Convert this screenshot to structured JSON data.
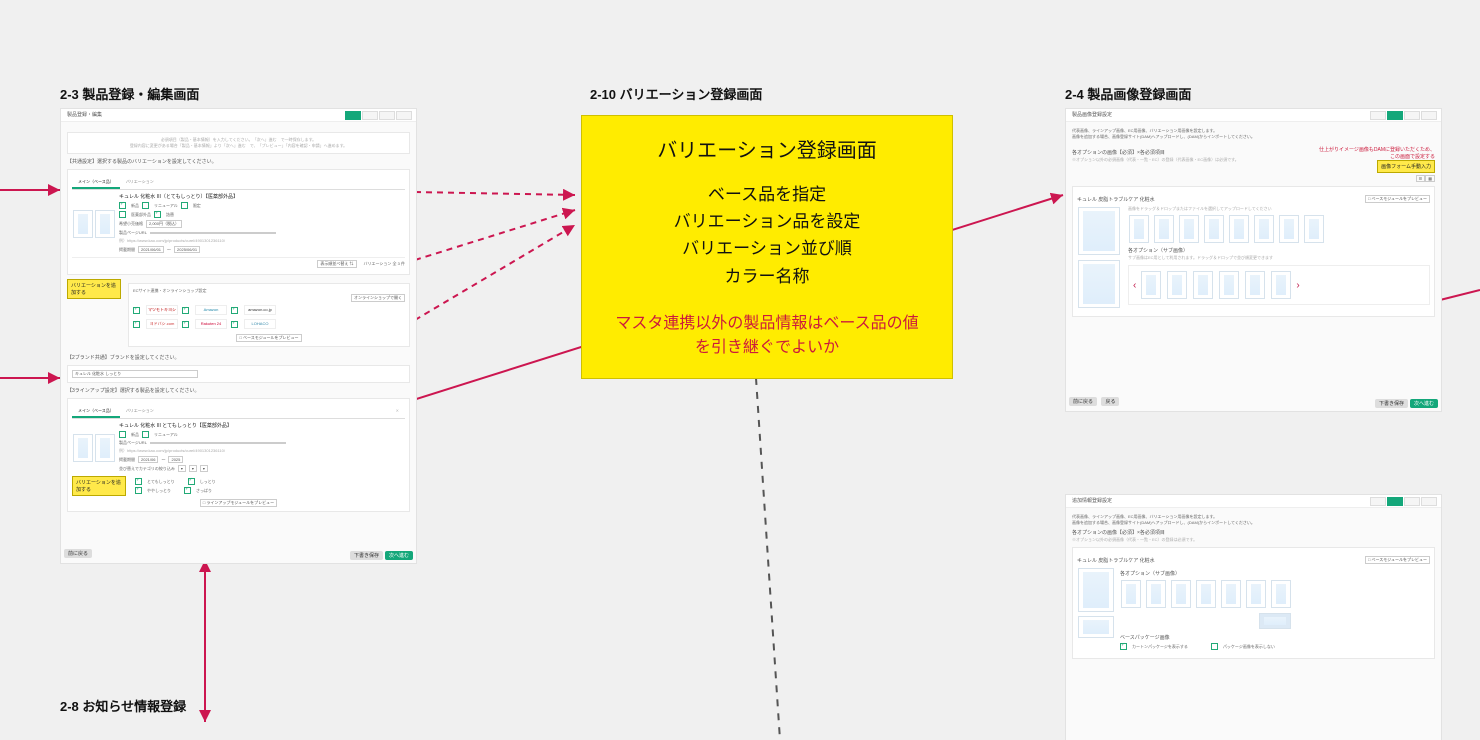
{
  "labels": {
    "s23": "2-3 製品登録・編集画面",
    "s210": "2-10 バリエーション登録画面",
    "s24": "2-4 製品画像登録画面",
    "s28": "2-8 お知らせ情報登録"
  },
  "yellow": {
    "title": "バリエーション登録画面",
    "line1": "ベース品を指定",
    "line2": "バリエーション品を設定",
    "line3": "バリエーション並び順",
    "line4": "カラー名称",
    "q1": "マスタ連携以外の製品情報はベース品の値",
    "q2": "を引き継ぐでよいか"
  },
  "m23": {
    "header": "製品登録・編集",
    "intro1": "必須項目（製品・基本情報）を入力してください。「次へ」進む　で一時保存します。",
    "intro2": "登録内容に変更がある場合「製品・基本情報」より「次へ」進む　で、「プレビュー」「内容を確認・申請」へ進めます。",
    "sec1_title": "【共通設定】選択する製品のバリエーションを設定してください。",
    "tab_main": "メイン（ベース品）",
    "tab_var": "バリエーション",
    "prod_name": "キュレル 化粧水 III（とてもしっとり）【医薬部外品】",
    "opts": [
      "新品",
      "リニューアル",
      "限定",
      "医薬部外品",
      "詰替"
    ],
    "field_price": "希望小売価格",
    "price_val": "2,000円（税込）",
    "field_url": "製品ページURL",
    "url_example": "例）https://www.kao.com/jp/products/curel/4901301236110/",
    "date_label": "掲載期間",
    "arrange": "表示順並べ替え ⇅",
    "total": "バリエーション 全 3 件",
    "add_variation": "バリエーションを追加する",
    "ec_title": "ECサイト連携・オンラインショップ設定",
    "ec_open": "オンラインショップで開く",
    "ec": [
      "マツモトキヨシ",
      "Amazon",
      "amazon.co.jp",
      "ヨドバシ.com",
      "Rakuten 24",
      "LOHACO"
    ],
    "preview": "□ ベースモジュールをプレビュー",
    "sec2_title": "【2ブランド共通】ブランドを設定してください。",
    "brand_val": "キュレル 化粧水 しっとり",
    "sec3_title": "【3ラインアップ設定】選択する製品を設定してください。",
    "lineup_name": "キュレル 化粧水 III とてもしっとり【医薬部外品】",
    "sort_text": "並び替えでカテゴリの絞り込み",
    "lopts": [
      "とてもしっとり",
      "しっとり",
      "ややしっとり",
      "さっぱり"
    ],
    "preview2": "□ ラインアップモジュールをプレビュー",
    "back": "前に戻る",
    "draft": "下書き保存",
    "next": "次へ進む"
  },
  "m24": {
    "header": "製品画像登録設定",
    "desc1": "代表画像、ラインアップ画像、EC用画像、バリエーション用画像を設定します。",
    "desc2": "画像を追加する場合、画像登録サイト(DAM)へアップロードし、(DAM)からインポートしてください。",
    "red1": "仕上がりイメージ画像もDAMに登録いただくため、",
    "red2": "この画面で設定する",
    "yellow_note": "画像フォーム手動入力",
    "sec_title": "各オプションの画像【必須】×各必須項目",
    "req_note": "※オプション以外の必須画像（代表・一覧・EC）の登録（代表画像・EC画像）は必須です。",
    "grid_title": "キュレル 皮脂トラブルケア 化粧水",
    "grid_note": "画像をドラッグ＆ドロップまたはファイルを選択してアップロードしてください",
    "opt_title": "各オプション（サブ画像）",
    "opt_note": "サブ画像はEC用として利用されます。ドラッグ＆ドロップで並び順変更できます",
    "preview": "□ ベースモジュールをプレビュー",
    "back": "前に戻る",
    "prev": "戻る",
    "draft": "下書き保存",
    "next": "次へ進む"
  },
  "mE": {
    "header": "追加情報登録設定",
    "desc1": "代表画像、ラインアップ画像、EC用画像、バリエーション用画像を設定します。",
    "desc2": "画像を追加する場合、画像登録サイト(DAM)へアップロードし、(DAM)からインポートしてください。",
    "sec_title": "各オプションの画像【必須】×各必須項目",
    "req_note": "※オプション以外の必須画像（代表・一覧・EC）の登録は必須です。",
    "grid_title": "キュレル 皮脂トラブルケア 化粧水",
    "opt_title": "各オプション（サブ画像）",
    "pkg_title": "ベースパッケージ画像",
    "pkg1": "カートンパッケージを表示する",
    "pkg2": "パッケージ画像を表示しない",
    "preview": "□ ベースモジュールをプレビュー"
  }
}
